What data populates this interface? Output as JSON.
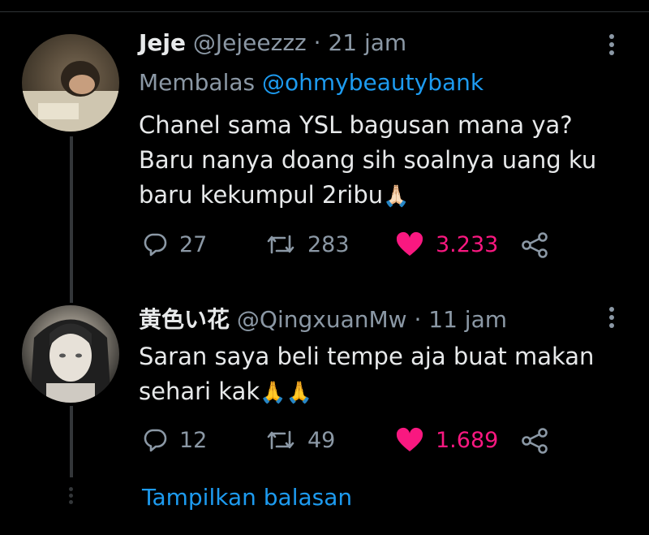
{
  "tweet1": {
    "name": "Jeje",
    "handle": "@Jejeezzz",
    "separator": "·",
    "time": "21 jam",
    "replying_prefix": "Membalas",
    "replying_to": "@ohmybeautybank",
    "line1": "Chanel sama YSL bagusan mana ya?",
    "line2": "Baru nanya doang sih soalnya uang ku",
    "line3": "baru kekumpul 2ribu",
    "emoji": "🙏🏻",
    "replies": "27",
    "retweets": "283",
    "likes": "3.233"
  },
  "tweet2": {
    "name": "黄色い花",
    "handle": "@QingxuanMw",
    "separator": "·",
    "time": "11 jam",
    "line1": "Saran saya beli tempe aja buat makan",
    "line2": "sehari kak",
    "emoji": "🙏🙏",
    "replies": "12",
    "retweets": "49",
    "likes": "1.689"
  },
  "show_replies_label": "Tampilkan balasan",
  "icons": {
    "reply": "reply-icon",
    "retweet": "retweet-icon",
    "like": "heart-icon",
    "share": "share-icon",
    "more": "more-icon"
  },
  "colors": {
    "background": "#000000",
    "text": "#e7e9ea",
    "muted": "#8b98a5",
    "link": "#1d9bf0",
    "liked": "#f91880"
  }
}
